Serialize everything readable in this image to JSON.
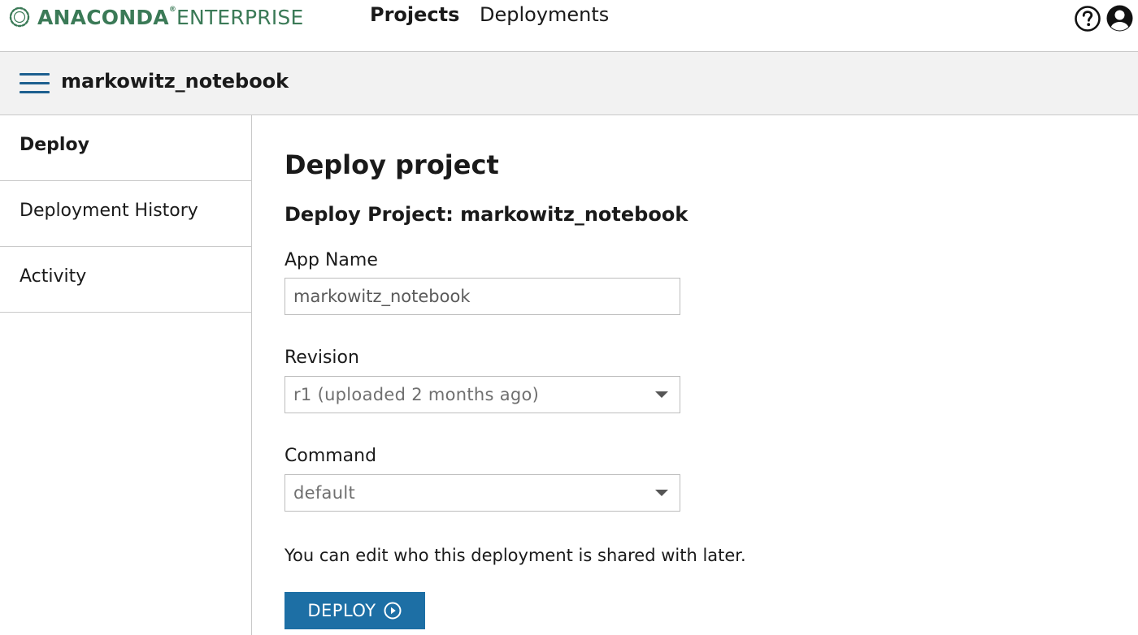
{
  "brand": {
    "name_bold": "ANACONDA",
    "registered": "®",
    "name_light": "ENTERPRISE",
    "color": "#3b7a57"
  },
  "nav": {
    "tabs": [
      {
        "label": "Projects",
        "active": true
      },
      {
        "label": "Deployments",
        "active": false
      }
    ],
    "icons": [
      "help-circle-icon",
      "user-account-icon"
    ]
  },
  "project": {
    "name": "markowitz_notebook",
    "menu_icon": "hamburger-menu-icon"
  },
  "sidebar": {
    "items": [
      {
        "label": "Deploy",
        "active": true
      },
      {
        "label": "Deployment History",
        "active": false
      },
      {
        "label": "Activity",
        "active": false
      }
    ]
  },
  "main": {
    "title": "Deploy project",
    "subtitle": "Deploy Project: markowitz_notebook",
    "app_name": {
      "label": "App Name",
      "value": "markowitz_notebook"
    },
    "revision": {
      "label": "Revision",
      "selected": "r1 (uploaded 2 months ago)"
    },
    "command": {
      "label": "Command",
      "selected": "default"
    },
    "share_note": "You can edit who this deployment is shared with later.",
    "deploy_button": {
      "label": "DEPLOY",
      "icon": "play-circle-icon",
      "color": "#1d6fa5"
    }
  },
  "colors": {
    "accent": "#1d6fa5",
    "header_bg": "#f2f2f2",
    "border": "#c9c9c9"
  }
}
